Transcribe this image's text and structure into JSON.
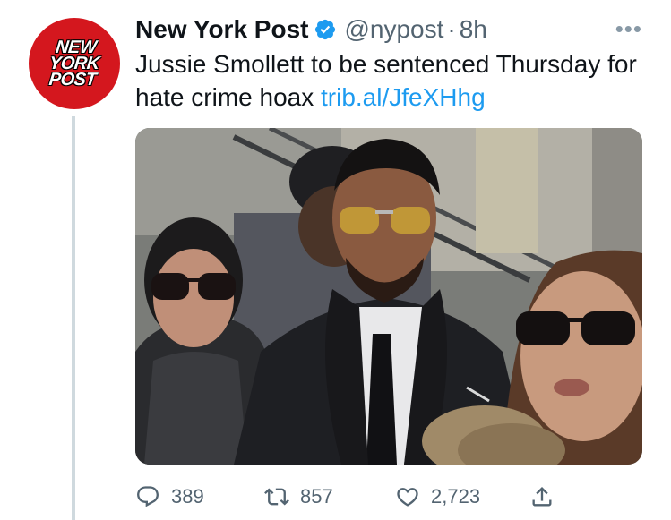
{
  "account": {
    "avatar_text_lines": [
      "NEW",
      "YORK",
      "POST"
    ],
    "name": "New York Post",
    "handle": "@nypost",
    "separator": "·",
    "time": "8h",
    "more_icon": "ellipsis-icon",
    "verified_color": "#1d9bf0"
  },
  "tweet": {
    "text": "Jussie Smollett to be sentenced Thursday for hate crime hoax ",
    "link": "trib.al/JfeXHhg"
  },
  "media": {
    "image_description_icon": "photo"
  },
  "actions": {
    "reply_count": "389",
    "retweet_count": "857",
    "like_count": "2,723"
  },
  "colors": {
    "brand_red": "#d4171e",
    "link_blue": "#1d9bf0",
    "muted_text": "#536471"
  }
}
